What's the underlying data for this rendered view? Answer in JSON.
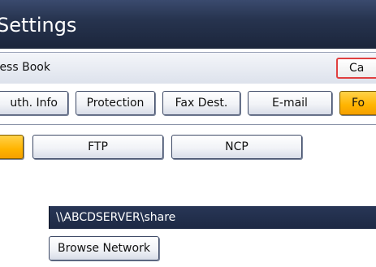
{
  "window": {
    "title": "Settings"
  },
  "address_book_bar": {
    "label": "ress Book",
    "cancel_label": "Ca"
  },
  "tabs": [
    {
      "label": "uth. Info",
      "selected": false
    },
    {
      "label": "Protection",
      "selected": false
    },
    {
      "label": "Fax Dest.",
      "selected": false
    },
    {
      "label": "E-mail",
      "selected": false
    },
    {
      "label": "Fo",
      "selected": true
    }
  ],
  "protocol_tabs": [
    {
      "label": "",
      "selected": true
    },
    {
      "label": "FTP",
      "selected": false
    },
    {
      "label": "NCP",
      "selected": false
    }
  ],
  "path": {
    "value": "\\\\ABCDSERVER\\share"
  },
  "browse": {
    "label": "Browse Network"
  },
  "colors": {
    "titlebar": "#27344f",
    "selected_tab": "#ffb400",
    "cancel_border": "#e04040",
    "path_field": "#1d2944"
  }
}
